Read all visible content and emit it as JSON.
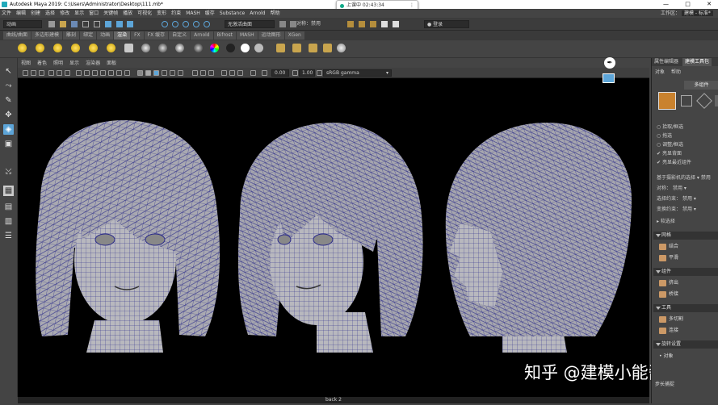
{
  "window": {
    "title": "Autodesk Maya 2019: C:\\Users\\Administrator\\Desktop\\111.mb*",
    "controls": [
      "—",
      "□",
      "✕"
    ]
  },
  "recording": {
    "label": "上课中 02:43:34"
  },
  "menus": [
    "文件",
    "编辑",
    "创建",
    "选择",
    "修改",
    "显示",
    "窗口",
    "关键帧",
    "播放",
    "可视化",
    "变形",
    "约束",
    "MASH",
    "缓存",
    "Substance",
    "Arnold",
    "帮助"
  ],
  "workspace": {
    "label": "工作区：",
    "value": "建模 - 标准*"
  },
  "status": {
    "mode": "动画",
    "symmetry": "对称：禁用",
    "live_surface": "无激活曲面",
    "login": "登录"
  },
  "shelf_tabs": [
    "曲线/曲面",
    "多边形建模",
    "雕刻",
    "绑定",
    "动画",
    "渲染",
    "FX",
    "FX 缓存",
    "自定义",
    "Arnold",
    "Bifrost",
    "MASH",
    "运动图形",
    "XGen"
  ],
  "shelf_active": "渲染",
  "viewport_menu": [
    "视图",
    "着色",
    "照明",
    "显示",
    "渲染器",
    "面板"
  ],
  "viewport_toolbar": {
    "exposure": "0.00",
    "gamma": "1.00",
    "colorspace": "sRGB gamma"
  },
  "camera_label": "back 2",
  "right_panel": {
    "tabs": [
      "属性编辑器",
      "建模工具包"
    ],
    "active_tab": "建模工具包",
    "menus": [
      "对象",
      "帮助"
    ],
    "mode_button": "多组件",
    "options": [
      {
        "label": "拾取/框选",
        "checked": false
      },
      {
        "label": "拖选",
        "checked": false
      },
      {
        "label": "调整/框选",
        "checked": false
      },
      {
        "label": "亮显背面",
        "checked": true
      },
      {
        "label": "亮显最近组件",
        "checked": true
      }
    ],
    "selection_rows": [
      {
        "label": "基于摄影机的选择",
        "value": "禁用"
      },
      {
        "label": "对称：",
        "value": "禁用"
      },
      {
        "label": "选择约束：",
        "value": "禁用"
      },
      {
        "label": "变换约束：",
        "value": "禁用"
      }
    ],
    "soft_select": "软选择",
    "sections": [
      {
        "title": "网格",
        "items": [
          "结合",
          "平滑"
        ]
      },
      {
        "title": "组件",
        "items": [
          "挤出",
          "桥接"
        ]
      },
      {
        "title": "工具",
        "items": [
          "多切割",
          "连接"
        ]
      },
      {
        "title": "旋转设置",
        "items": [
          "对象"
        ]
      }
    ],
    "footer": "步长捕捉"
  },
  "watermark": "知乎 @建模小能酱"
}
